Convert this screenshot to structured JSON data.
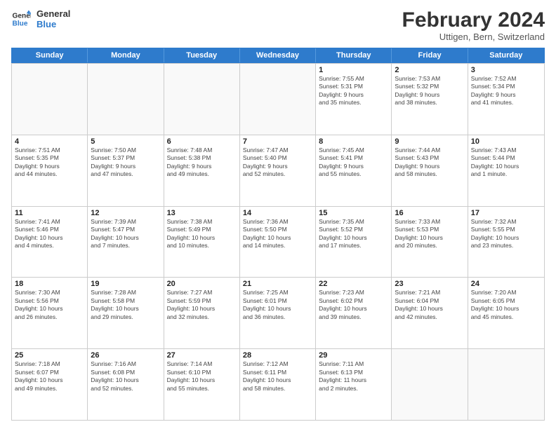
{
  "header": {
    "logo_line1": "General",
    "logo_line2": "Blue",
    "month_title": "February 2024",
    "location": "Uttigen, Bern, Switzerland"
  },
  "weekdays": [
    "Sunday",
    "Monday",
    "Tuesday",
    "Wednesday",
    "Thursday",
    "Friday",
    "Saturday"
  ],
  "rows": [
    [
      {
        "day": "",
        "info": ""
      },
      {
        "day": "",
        "info": ""
      },
      {
        "day": "",
        "info": ""
      },
      {
        "day": "",
        "info": ""
      },
      {
        "day": "1",
        "info": "Sunrise: 7:55 AM\nSunset: 5:31 PM\nDaylight: 9 hours\nand 35 minutes."
      },
      {
        "day": "2",
        "info": "Sunrise: 7:53 AM\nSunset: 5:32 PM\nDaylight: 9 hours\nand 38 minutes."
      },
      {
        "day": "3",
        "info": "Sunrise: 7:52 AM\nSunset: 5:34 PM\nDaylight: 9 hours\nand 41 minutes."
      }
    ],
    [
      {
        "day": "4",
        "info": "Sunrise: 7:51 AM\nSunset: 5:35 PM\nDaylight: 9 hours\nand 44 minutes."
      },
      {
        "day": "5",
        "info": "Sunrise: 7:50 AM\nSunset: 5:37 PM\nDaylight: 9 hours\nand 47 minutes."
      },
      {
        "day": "6",
        "info": "Sunrise: 7:48 AM\nSunset: 5:38 PM\nDaylight: 9 hours\nand 49 minutes."
      },
      {
        "day": "7",
        "info": "Sunrise: 7:47 AM\nSunset: 5:40 PM\nDaylight: 9 hours\nand 52 minutes."
      },
      {
        "day": "8",
        "info": "Sunrise: 7:45 AM\nSunset: 5:41 PM\nDaylight: 9 hours\nand 55 minutes."
      },
      {
        "day": "9",
        "info": "Sunrise: 7:44 AM\nSunset: 5:43 PM\nDaylight: 9 hours\nand 58 minutes."
      },
      {
        "day": "10",
        "info": "Sunrise: 7:43 AM\nSunset: 5:44 PM\nDaylight: 10 hours\nand 1 minute."
      }
    ],
    [
      {
        "day": "11",
        "info": "Sunrise: 7:41 AM\nSunset: 5:46 PM\nDaylight: 10 hours\nand 4 minutes."
      },
      {
        "day": "12",
        "info": "Sunrise: 7:39 AM\nSunset: 5:47 PM\nDaylight: 10 hours\nand 7 minutes."
      },
      {
        "day": "13",
        "info": "Sunrise: 7:38 AM\nSunset: 5:49 PM\nDaylight: 10 hours\nand 10 minutes."
      },
      {
        "day": "14",
        "info": "Sunrise: 7:36 AM\nSunset: 5:50 PM\nDaylight: 10 hours\nand 14 minutes."
      },
      {
        "day": "15",
        "info": "Sunrise: 7:35 AM\nSunset: 5:52 PM\nDaylight: 10 hours\nand 17 minutes."
      },
      {
        "day": "16",
        "info": "Sunrise: 7:33 AM\nSunset: 5:53 PM\nDaylight: 10 hours\nand 20 minutes."
      },
      {
        "day": "17",
        "info": "Sunrise: 7:32 AM\nSunset: 5:55 PM\nDaylight: 10 hours\nand 23 minutes."
      }
    ],
    [
      {
        "day": "18",
        "info": "Sunrise: 7:30 AM\nSunset: 5:56 PM\nDaylight: 10 hours\nand 26 minutes."
      },
      {
        "day": "19",
        "info": "Sunrise: 7:28 AM\nSunset: 5:58 PM\nDaylight: 10 hours\nand 29 minutes."
      },
      {
        "day": "20",
        "info": "Sunrise: 7:27 AM\nSunset: 5:59 PM\nDaylight: 10 hours\nand 32 minutes."
      },
      {
        "day": "21",
        "info": "Sunrise: 7:25 AM\nSunset: 6:01 PM\nDaylight: 10 hours\nand 36 minutes."
      },
      {
        "day": "22",
        "info": "Sunrise: 7:23 AM\nSunset: 6:02 PM\nDaylight: 10 hours\nand 39 minutes."
      },
      {
        "day": "23",
        "info": "Sunrise: 7:21 AM\nSunset: 6:04 PM\nDaylight: 10 hours\nand 42 minutes."
      },
      {
        "day": "24",
        "info": "Sunrise: 7:20 AM\nSunset: 6:05 PM\nDaylight: 10 hours\nand 45 minutes."
      }
    ],
    [
      {
        "day": "25",
        "info": "Sunrise: 7:18 AM\nSunset: 6:07 PM\nDaylight: 10 hours\nand 49 minutes."
      },
      {
        "day": "26",
        "info": "Sunrise: 7:16 AM\nSunset: 6:08 PM\nDaylight: 10 hours\nand 52 minutes."
      },
      {
        "day": "27",
        "info": "Sunrise: 7:14 AM\nSunset: 6:10 PM\nDaylight: 10 hours\nand 55 minutes."
      },
      {
        "day": "28",
        "info": "Sunrise: 7:12 AM\nSunset: 6:11 PM\nDaylight: 10 hours\nand 58 minutes."
      },
      {
        "day": "29",
        "info": "Sunrise: 7:11 AM\nSunset: 6:13 PM\nDaylight: 11 hours\nand 2 minutes."
      },
      {
        "day": "",
        "info": ""
      },
      {
        "day": "",
        "info": ""
      }
    ]
  ]
}
